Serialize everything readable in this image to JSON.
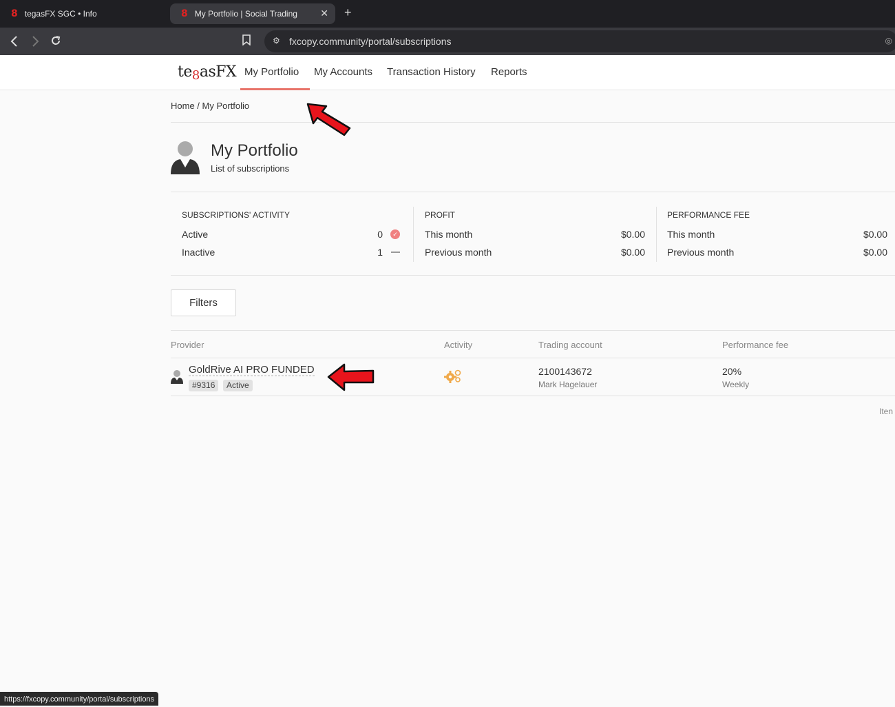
{
  "browser": {
    "tabs": [
      {
        "title": "tegasFX SGC • Info",
        "favicon": "8"
      },
      {
        "title": "My Portfolio | Social Trading",
        "favicon": "8"
      }
    ],
    "new_tab": "+",
    "close_tab": "✕",
    "url": "fxcopy.community/portal/subscriptions",
    "status_url": "https://fxcopy.community/portal/subscriptions"
  },
  "site": {
    "logo": {
      "pre": "te",
      "eight": "8",
      "post": "asFX"
    },
    "nav": [
      "My Portfolio",
      "My Accounts",
      "Transaction History",
      "Reports"
    ]
  },
  "breadcrumb": "Home  /  My Portfolio",
  "page": {
    "title": "My Portfolio",
    "subtitle": "List of subscriptions"
  },
  "stats": {
    "subscriptions": {
      "heading": "SUBSCRIPTIONS' ACTIVITY",
      "active_label": "Active",
      "active_value": "0",
      "inactive_label": "Inactive",
      "inactive_value": "1"
    },
    "profit": {
      "heading": "PROFIT",
      "this_month_label": "This month",
      "this_month_value": "$0.00",
      "prev_month_label": "Previous month",
      "prev_month_value": "$0.00"
    },
    "performance_fee": {
      "heading": "PERFORMANCE FEE",
      "this_month_label": "This month",
      "this_month_value": "$0.00",
      "prev_month_label": "Previous month",
      "prev_month_value": "$0.00"
    }
  },
  "filters_label": "Filters",
  "table": {
    "headers": [
      "Provider",
      "Activity",
      "Trading account",
      "Performance fee"
    ],
    "rows": [
      {
        "provider": "GoldRive AI PRO FUNDED",
        "id": "#9316",
        "status": "Active",
        "account": "2100143672",
        "owner": "Mark Hagelauer",
        "fee": "20%",
        "fee_period": "Weekly"
      }
    ],
    "footer": "Iten"
  },
  "colors": {
    "accent": "#e8746a",
    "annotation_arrow": "#e8141c"
  }
}
